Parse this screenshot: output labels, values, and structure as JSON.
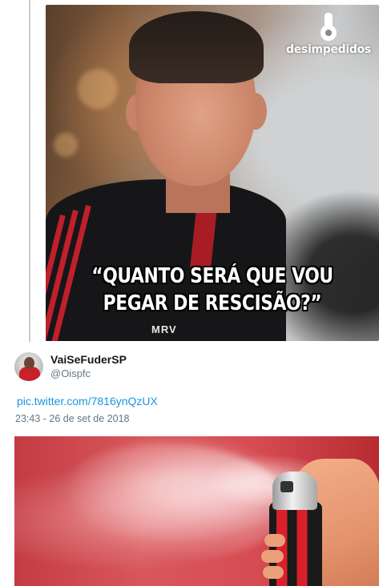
{
  "meme": {
    "watermark_brand": "desimpedidos",
    "caption_line1": "“QUANTO SERÁ QUE VOU",
    "caption_line2": "PEGAR DE RESCISÃO?”",
    "jersey_mark": "MRV"
  },
  "tweet": {
    "display_name": "VaiSeFuderSP",
    "handle": "@Oispfc",
    "link_text": "pic.twitter.com/7816ynQzUX",
    "timestamp": "23:43 - 26 de set de 2018"
  },
  "colors": {
    "link": "#1b95e0",
    "secondary_text": "#657786",
    "thread_line": "#c4cfd6"
  },
  "icons": {
    "watermark": "desimpedidos-whistle-logo"
  }
}
